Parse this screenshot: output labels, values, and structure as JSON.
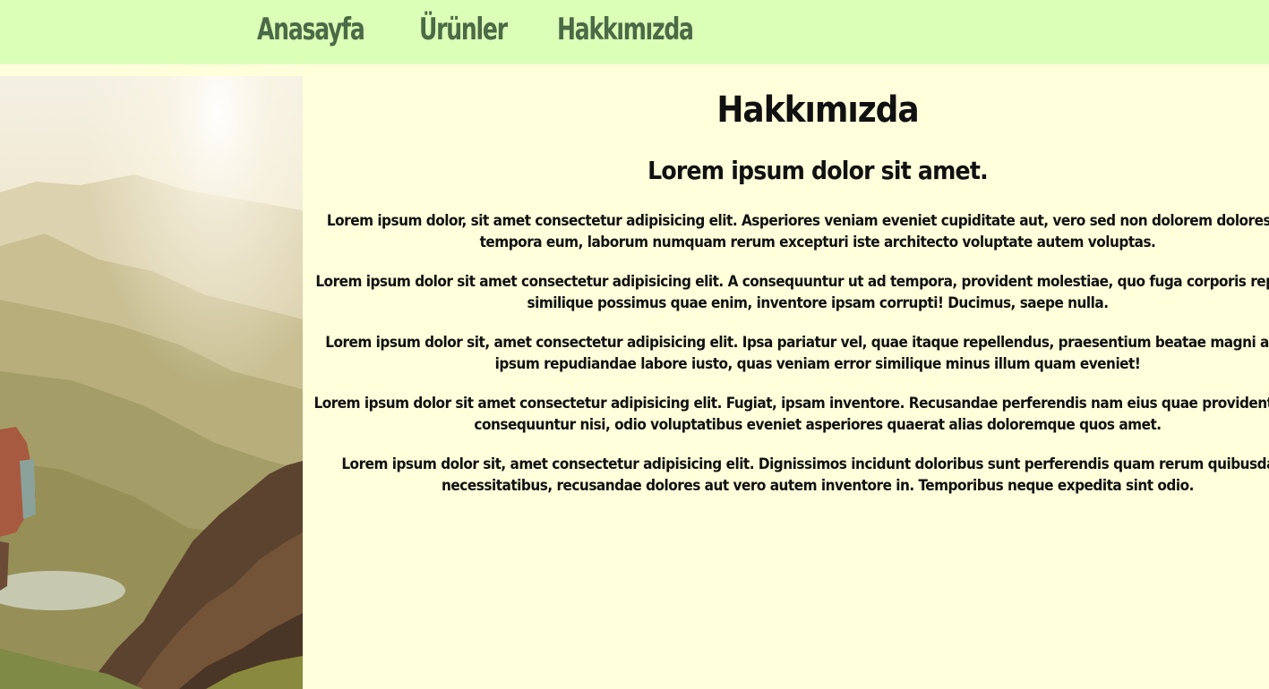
{
  "nav": {
    "items": [
      {
        "label": "Anasayfa"
      },
      {
        "label": "Ürünler"
      },
      {
        "label": "Hakkımızda"
      }
    ]
  },
  "hero_image": {
    "icon": "mountain-hiker-photo"
  },
  "about": {
    "title": "Hakkımızda",
    "subtitle": "Lorem ipsum dolor sit amet.",
    "paragraphs": [
      {
        "line1": "Lorem ipsum dolor, sit amet consectetur adipisicing elit. Asperiores veniam eveniet cupiditate aut, vero sed non dolorem dolores aper",
        "line2": "tempora eum, laborum numquam rerum excepturi iste architecto voluptate autem voluptas."
      },
      {
        "line1": "Lorem ipsum dolor sit amet consectetur adipisicing elit. A consequuntur ut ad tempora, provident molestiae, quo fuga corporis repellend",
        "line2": "similique possimus quae enim, inventore ipsam corrupti! Ducimus, saepe nulla."
      },
      {
        "line1": "Lorem ipsum dolor sit, amet consectetur adipisicing elit. Ipsa pariatur vel, quae itaque repellendus, praesentium beatae magni accusa",
        "line2": "ipsum repudiandae labore iusto, quas veniam error similique minus illum quam eveniet!"
      },
      {
        "line1": "Lorem ipsum dolor sit amet consectetur adipisicing elit. Fugiat, ipsam inventore. Recusandae perferendis nam eius quae provident omnis",
        "line2": "consequuntur nisi, odio voluptatibus eveniet asperiores quaerat alias doloremque quos amet."
      },
      {
        "line1": "Lorem ipsum dolor sit, amet consectetur adipisicing elit. Dignissimos incidunt doloribus sunt perferendis quam rerum quibusdam,",
        "line2": "necessitatibus, recusandae dolores aut vero autem inventore in. Temporibus neque expedita sint odio."
      }
    ]
  },
  "colors": {
    "navbar_bg": "#dcffb8",
    "nav_text": "#4a6b45",
    "page_bg": "#ffffdb",
    "body_text": "#111111"
  }
}
